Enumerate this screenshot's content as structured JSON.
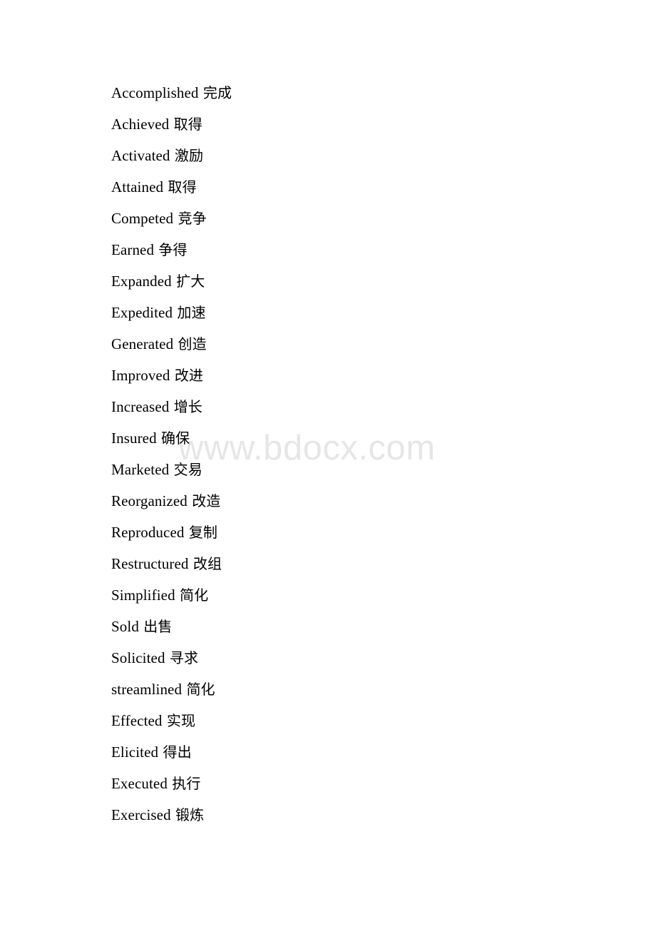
{
  "document": {
    "background_color": "#ffffff",
    "text_color": "#000000",
    "watermark": {
      "text": "www.bdocx.com",
      "color": "#e6e6e6"
    },
    "entries": [
      {
        "en": "Accomplished",
        "zh": "完成"
      },
      {
        "en": "Achieved",
        "zh": "取得"
      },
      {
        "en": "Activated",
        "zh": "激励"
      },
      {
        "en": "Attained",
        "zh": "取得"
      },
      {
        "en": "Competed",
        "zh": "竞争"
      },
      {
        "en": "Earned",
        "zh": "争得"
      },
      {
        "en": "Expanded",
        "zh": "扩大"
      },
      {
        "en": "Expedited",
        "zh": "加速"
      },
      {
        "en": "Generated",
        "zh": "创造"
      },
      {
        "en": "Improved",
        "zh": "改进"
      },
      {
        "en": "Increased",
        "zh": "增长"
      },
      {
        "en": "Insured",
        "zh": "确保"
      },
      {
        "en": "Marketed",
        "zh": "交易"
      },
      {
        "en": "Reorganized",
        "zh": "改造"
      },
      {
        "en": "Reproduced",
        "zh": "复制"
      },
      {
        "en": "Restructured",
        "zh": "改组"
      },
      {
        "en": "Simplified",
        "zh": "简化"
      },
      {
        "en": "Sold",
        "zh": "出售"
      },
      {
        "en": "Solicited",
        "zh": "寻求"
      },
      {
        "en": "streamlined",
        "zh": "简化"
      },
      {
        "en": "Effected",
        "zh": "实现"
      },
      {
        "en": "Elicited",
        "zh": "得出"
      },
      {
        "en": "Executed",
        "zh": "执行"
      },
      {
        "en": "Exercised",
        "zh": "锻炼"
      }
    ]
  }
}
